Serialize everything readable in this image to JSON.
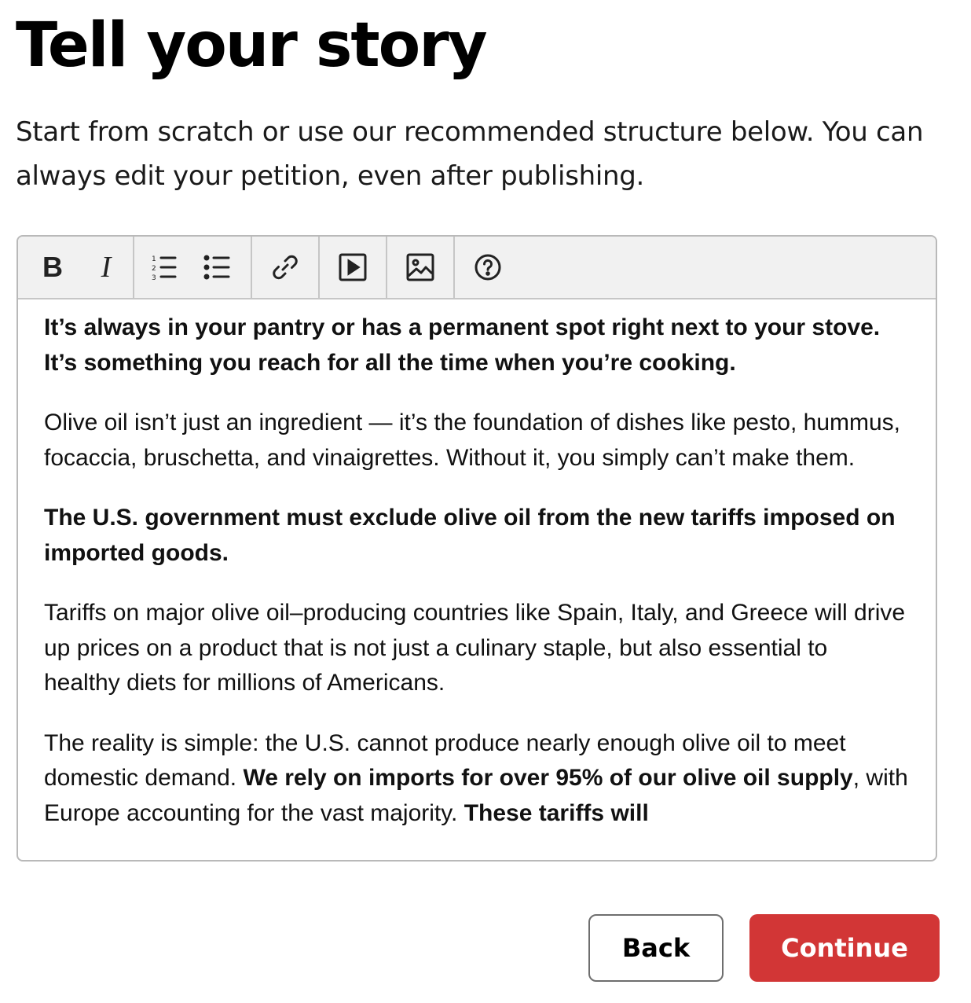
{
  "page": {
    "title": "Tell your story",
    "intro": "Start from scratch or use our recommended structure below. You can always edit your petition, even after publishing."
  },
  "toolbar": {
    "buttons": [
      {
        "name": "bold",
        "label": "B"
      },
      {
        "name": "italic",
        "label": "I"
      },
      {
        "name": "numbered-list",
        "icon": "numbered-list-icon"
      },
      {
        "name": "bulleted-list",
        "icon": "bulleted-list-icon"
      },
      {
        "name": "link",
        "icon": "link-icon"
      },
      {
        "name": "video",
        "icon": "video-icon"
      },
      {
        "name": "image",
        "icon": "image-icon"
      },
      {
        "name": "help",
        "icon": "help-icon"
      }
    ]
  },
  "story": {
    "p1_bold": "It’s always in your pantry or has a permanent spot right next to your stove. It’s something you reach for all the time when you’re cooking.",
    "p2": "Olive oil isn’t just an ingredient — it’s the foundation of dishes like pesto, hummus, focaccia, bruschetta, and vinaigrettes. Without it, you simply can’t make them.",
    "p3_bold": "The U.S. government must exclude olive oil from the new tariffs imposed on imported goods.",
    "p4": "Tariffs on major olive oil–producing countries like Spain, Italy, and Greece will drive up prices on a product that is not just a culinary staple, but also essential to healthy diets for millions of Americans.",
    "p5_a": "The reality is simple: the U.S. cannot produce nearly enough olive oil to meet domestic demand. ",
    "p5_b_bold": "We rely on imports for over 95% of our olive oil supply",
    "p5_c": ", with Europe accounting for the vast majority. ",
    "p5_d_bold": "These tariffs will"
  },
  "actions": {
    "back_label": "Back",
    "continue_label": "Continue"
  },
  "colors": {
    "continue_bg": "#d23636",
    "toolbar_bg": "#f1f1f1"
  }
}
